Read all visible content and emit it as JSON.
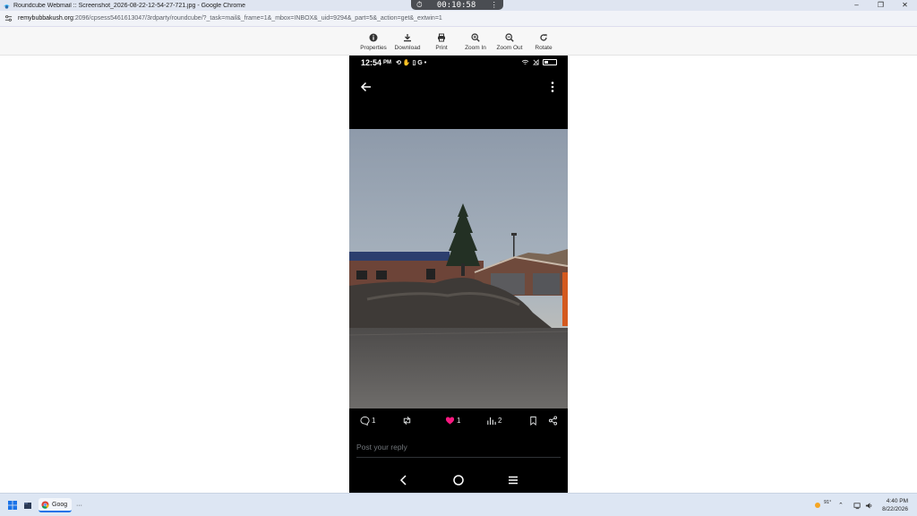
{
  "window": {
    "title": "Roundcube Webmail :: Screenshot_2026-08-22-12-54-27-721.jpg - Google Chrome",
    "controls": {
      "minimize": "–",
      "restore": "❐",
      "close": "✕"
    }
  },
  "timer": {
    "icon": "stopwatch-icon",
    "value": "00:10:58",
    "menu": "⋮"
  },
  "address": {
    "host": "remybubbakush.org",
    "path": ":2096/cpsess5461613047/3rdparty/roundcube/?_task=mail&_frame=1&_mbox=INBOX&_uid=9294&_part=5&_action=get&_extwin=1"
  },
  "toolbar": {
    "items": [
      {
        "label": "Properties",
        "icon": "info-icon"
      },
      {
        "label": "Download",
        "icon": "download-icon"
      },
      {
        "label": "Print",
        "icon": "print-icon"
      },
      {
        "label": "Zoom In",
        "icon": "zoom-in-icon"
      },
      {
        "label": "Zoom Out",
        "icon": "zoom-out-icon"
      },
      {
        "label": "Rotate",
        "icon": "rotate-icon"
      }
    ]
  },
  "phone": {
    "status": {
      "time": "12:54",
      "ampm": "PM",
      "icons": "⟲ ✋ ▯ G •",
      "battery_level": 0.35
    },
    "post": {
      "replies": "1",
      "likes": "1",
      "views": "2"
    },
    "reply_placeholder": "Post your reply"
  },
  "taskbar": {
    "chrome_label": "Goog",
    "more": "···",
    "weather": "91°",
    "clock_time": "4:40 PM",
    "clock_date": "8/22/2026"
  },
  "colors": {
    "like_pink": "#f91880",
    "taskbar_bg": "#dde6f3",
    "accent_blue": "#1a73e8"
  }
}
